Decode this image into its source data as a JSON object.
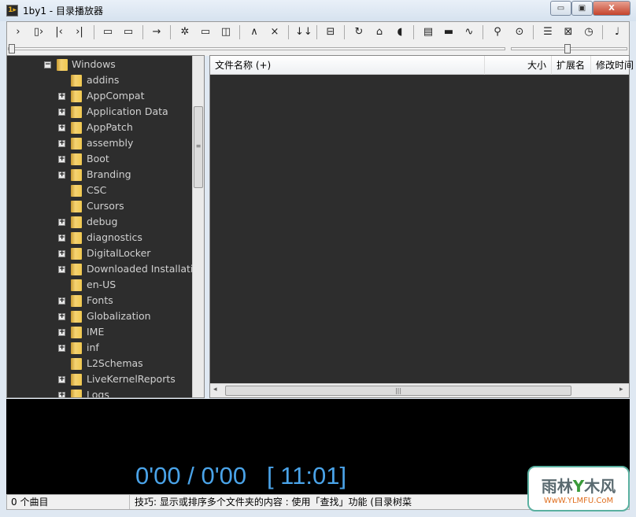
{
  "window": {
    "title": "1by1 - 目录播放器",
    "icon": "1by1-app-icon"
  },
  "toolbar": {
    "buttons": [
      {
        "name": "play-icon",
        "glyph": "›"
      },
      {
        "name": "play-next-icon",
        "glyph": "▯›"
      },
      {
        "name": "previous-icon",
        "glyph": "|‹"
      },
      {
        "name": "next-icon",
        "glyph": "›|"
      },
      {
        "name": "prev-folder-icon",
        "glyph": "▭"
      },
      {
        "name": "next-folder-icon",
        "glyph": "▭"
      },
      {
        "name": "arrow-right-icon",
        "glyph": "→"
      },
      {
        "name": "gear-icon",
        "glyph": "✲"
      },
      {
        "name": "mini-window-icon",
        "glyph": "▭"
      },
      {
        "name": "panel-icon",
        "glyph": "◫"
      },
      {
        "name": "chevron-up-icon",
        "glyph": "∧"
      },
      {
        "name": "close-icon",
        "glyph": "×"
      },
      {
        "name": "sort-down-icon",
        "glyph": "↓↓"
      },
      {
        "name": "split-view-icon",
        "glyph": "⊟"
      },
      {
        "name": "repeat-icon",
        "glyph": "↻"
      },
      {
        "name": "home-icon",
        "glyph": "⌂"
      },
      {
        "name": "volume-icon",
        "glyph": "◖"
      },
      {
        "name": "file-select-icon",
        "glyph": "▤"
      },
      {
        "name": "keyboard-icon",
        "glyph": "▬"
      },
      {
        "name": "wave-file-icon",
        "glyph": "∿"
      },
      {
        "name": "search-icon",
        "glyph": "⚲"
      },
      {
        "name": "zoom-search-icon",
        "glyph": "⊙"
      },
      {
        "name": "playlist-icon",
        "glyph": "☰"
      },
      {
        "name": "insert-icon",
        "glyph": "⊠"
      },
      {
        "name": "timer-icon",
        "glyph": "◷"
      },
      {
        "name": "output-icon",
        "glyph": "♩"
      }
    ],
    "position_slider": 0,
    "volume_slider": 0.4
  },
  "tree": {
    "root": "Windows",
    "items": [
      {
        "label": "addins",
        "exp": false
      },
      {
        "label": "AppCompat",
        "exp": true
      },
      {
        "label": "Application Data",
        "exp": true
      },
      {
        "label": "AppPatch",
        "exp": true
      },
      {
        "label": "assembly",
        "exp": true
      },
      {
        "label": "Boot",
        "exp": true
      },
      {
        "label": "Branding",
        "exp": true
      },
      {
        "label": "CSC",
        "exp": false
      },
      {
        "label": "Cursors",
        "exp": false
      },
      {
        "label": "debug",
        "exp": true
      },
      {
        "label": "diagnostics",
        "exp": true
      },
      {
        "label": "DigitalLocker",
        "exp": true
      },
      {
        "label": "Downloaded Installations",
        "exp": true
      },
      {
        "label": "en-US",
        "exp": false
      },
      {
        "label": "Fonts",
        "exp": true
      },
      {
        "label": "Globalization",
        "exp": true
      },
      {
        "label": "IME",
        "exp": true
      },
      {
        "label": "inf",
        "exp": true
      },
      {
        "label": "L2Schemas",
        "exp": false
      },
      {
        "label": "LiveKernelReports",
        "exp": true
      },
      {
        "label": "Logs",
        "exp": true
      }
    ]
  },
  "files": {
    "columns": [
      "文件名称 (+)",
      "大小",
      "扩展名",
      "修改时间"
    ]
  },
  "player": {
    "time": "0'00 / 0'00   [ 11:01]"
  },
  "status": {
    "count": "0 个曲目",
    "tip": "技巧: 显示或排序多个文件夹的内容 : 使用「查找」功能 (目录树菜"
  },
  "watermark": {
    "text": "雨林木风",
    "url": "WwW.YLMFU.CoM"
  },
  "colors": {
    "time": "#4aa3e8",
    "panel_bg": "#2d2d2d",
    "folder": "#f0c850"
  }
}
